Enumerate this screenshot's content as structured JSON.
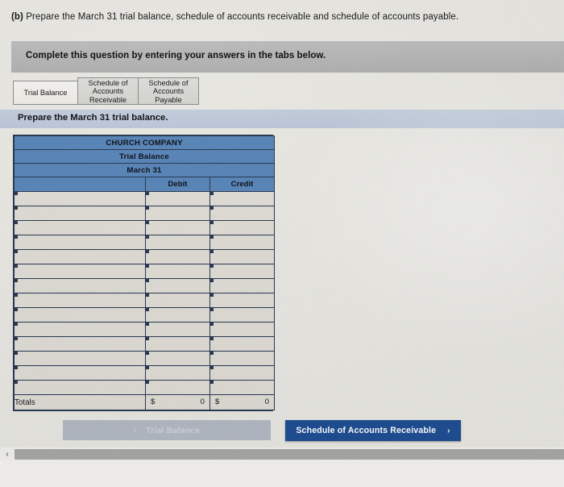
{
  "question": {
    "label": "(b)",
    "text": "Prepare the March 31 trial balance, schedule of accounts receivable and schedule of accounts payable."
  },
  "instruction": {
    "text": "Complete this question by entering your answers in the tabs below."
  },
  "tabs": [
    {
      "id": "trial-balance",
      "line1": "Trial Balance",
      "line2": "",
      "line3": "",
      "active": true
    },
    {
      "id": "schedule-accounts-receivable",
      "line1": "Schedule of",
      "line2": "Accounts",
      "line3": "Receivable",
      "active": false
    },
    {
      "id": "schedule-accounts-payable",
      "line1": "Schedule of",
      "line2": "Accounts",
      "line3": "Payable",
      "active": false
    }
  ],
  "subheader": {
    "text": "Prepare the March 31 trial balance."
  },
  "table": {
    "title_lines": [
      "CHURCH COMPANY",
      "Trial Balance",
      "March 31"
    ],
    "columns": [
      "",
      "Debit",
      "Credit"
    ],
    "empty_row_count": 14,
    "rows": [
      {
        "description": "",
        "debit": "",
        "credit": ""
      },
      {
        "description": "",
        "debit": "",
        "credit": ""
      },
      {
        "description": "",
        "debit": "",
        "credit": ""
      },
      {
        "description": "",
        "debit": "",
        "credit": ""
      },
      {
        "description": "",
        "debit": "",
        "credit": ""
      },
      {
        "description": "",
        "debit": "",
        "credit": ""
      },
      {
        "description": "",
        "debit": "",
        "credit": ""
      },
      {
        "description": "",
        "debit": "",
        "credit": ""
      },
      {
        "description": "",
        "debit": "",
        "credit": ""
      },
      {
        "description": "",
        "debit": "",
        "credit": ""
      },
      {
        "description": "",
        "debit": "",
        "credit": ""
      },
      {
        "description": "",
        "debit": "",
        "credit": ""
      },
      {
        "description": "",
        "debit": "",
        "credit": ""
      },
      {
        "description": "",
        "debit": "",
        "credit": ""
      }
    ],
    "totals": {
      "label": "Totals",
      "debit_symbol": "$",
      "debit_value": "0",
      "credit_symbol": "$",
      "credit_value": "0"
    }
  },
  "nav": {
    "prev_label": "Trial Balance",
    "prev_icon": "chevron-left-icon",
    "prev_chevron": "‹",
    "next_label": "Schedule of Accounts Receivable",
    "next_icon": "chevron-right-icon",
    "next_chevron": "›"
  },
  "scrollbar": {
    "left_arrow": "‹"
  },
  "colors": {
    "header_blue": "#5a86b8",
    "primary_button": "#1f4e93",
    "disabled_button": "#b3b9c4",
    "instruction_bar": "#b6b6b6",
    "subheader_bar": "#bcc7d8",
    "table_border": "#2b3a52"
  }
}
